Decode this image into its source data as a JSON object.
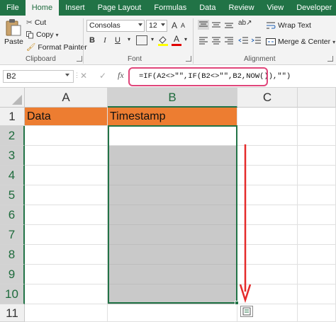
{
  "tabs": [
    "File",
    "Home",
    "Insert",
    "Page Layout",
    "Formulas",
    "Data",
    "Review",
    "View",
    "Developer"
  ],
  "active_tab": "Home",
  "clipboard": {
    "paste_label": "Paste",
    "cut_label": "Cut",
    "copy_label": "Copy",
    "format_painter_label": "Format Painter",
    "group_label": "Clipboard"
  },
  "font": {
    "font_name": "Consolas",
    "font_size": "12",
    "bold": "B",
    "italic": "I",
    "underline": "U",
    "grow": "A",
    "shrink": "A",
    "font_color_glyph": "A",
    "group_label": "Font"
  },
  "alignment": {
    "wrap_text_label": "Wrap Text",
    "merge_center_label": "Merge & Center",
    "group_label": "Alignment"
  },
  "formula_bar": {
    "name_box": "B2",
    "cancel_glyph": "✕",
    "enter_glyph": "✓",
    "fx_label": "fx",
    "formula": "=IF(A2<>\"\",IF(B2<>\"\",B2,NOW()),\"\")"
  },
  "grid": {
    "columns": [
      "A",
      "B",
      "C"
    ],
    "rows": [
      "1",
      "2",
      "3",
      "4",
      "5",
      "6",
      "7",
      "8",
      "9",
      "10",
      "11"
    ],
    "header_cells": {
      "A1": "Data",
      "B1": "Timestamp"
    },
    "header_fill": "#ed7d31",
    "selected_fill": "#c9c9c9"
  },
  "annotation": {
    "arrow_color": "#e52b2b",
    "highlight_color": "#e0457a"
  },
  "accent": "#217346"
}
